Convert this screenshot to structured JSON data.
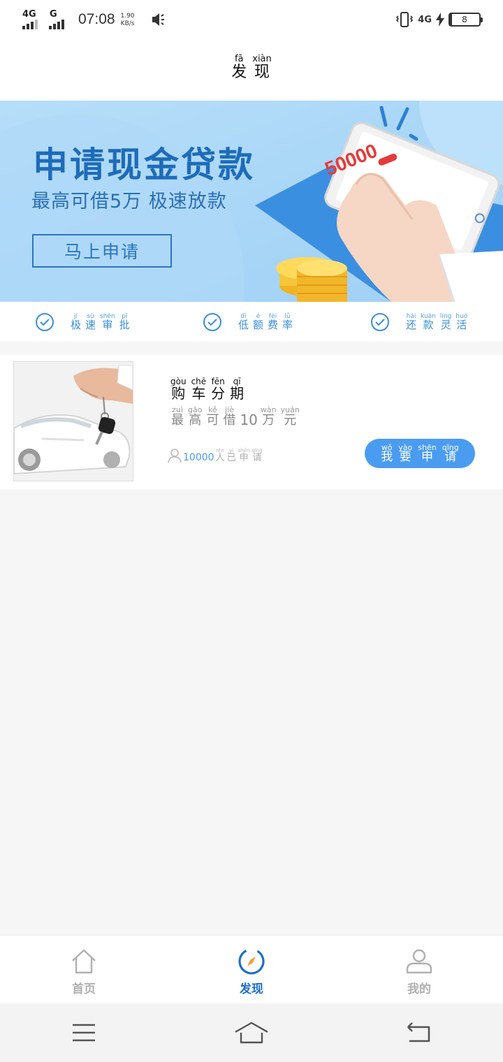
{
  "status_bar": {
    "sim1_type": "4G",
    "sim2_type": "G",
    "time": "07:08",
    "speed_value": "1.90",
    "speed_unit": "KB/s",
    "network_right": "4G",
    "battery_level": "8",
    "icons": [
      "mute-icon",
      "vibrate-icon",
      "charging-icon",
      "battery-icon"
    ]
  },
  "header": {
    "title": [
      {
        "char": "发",
        "pinyin": "fā"
      },
      {
        "char": "现",
        "pinyin": "xiàn"
      }
    ]
  },
  "banner": {
    "title": "申请现金贷款",
    "subtitle": "最高可借5万 极速放款",
    "button_label": "马上申请",
    "phone_amount": "50000",
    "colors": {
      "background": "#a6d6f7",
      "title": "#1e6cb9"
    }
  },
  "features": [
    {
      "chars": [
        {
          "char": "极",
          "pinyin": "jí"
        },
        {
          "char": "速",
          "pinyin": "sù"
        },
        {
          "char": "审",
          "pinyin": "shěn"
        },
        {
          "char": "批",
          "pinyin": "pī"
        }
      ]
    },
    {
      "chars": [
        {
          "char": "低",
          "pinyin": "dī"
        },
        {
          "char": "额",
          "pinyin": "é"
        },
        {
          "char": "费",
          "pinyin": "fèi"
        },
        {
          "char": "率",
          "pinyin": "lǜ"
        }
      ]
    },
    {
      "chars": [
        {
          "char": "还",
          "pinyin": "hái"
        },
        {
          "char": "款",
          "pinyin": "kuǎn"
        },
        {
          "char": "灵",
          "pinyin": "líng"
        },
        {
          "char": "活",
          "pinyin": "huó"
        }
      ]
    }
  ],
  "product": {
    "title": [
      {
        "char": "购",
        "pinyin": "gòu"
      },
      {
        "char": "车",
        "pinyin": "chē"
      },
      {
        "char": "分",
        "pinyin": "fēn"
      },
      {
        "char": "期",
        "pinyin": "qī"
      }
    ],
    "subtitle_before": [
      {
        "char": "最",
        "pinyin": "zuì"
      },
      {
        "char": "高",
        "pinyin": "gāo"
      },
      {
        "char": "可",
        "pinyin": "kě"
      },
      {
        "char": "借",
        "pinyin": "jiè"
      }
    ],
    "amount": "10",
    "subtitle_after": [
      {
        "char": "万",
        "pinyin": "wàn"
      },
      {
        "char": "元",
        "pinyin": "yuán"
      }
    ],
    "applicant_count": "10000",
    "applicant_label": [
      {
        "char": "人",
        "pinyin": "rén"
      },
      {
        "char": "已",
        "pinyin": "yǐ"
      },
      {
        "char": "申",
        "pinyin": "shēn"
      },
      {
        "char": "请",
        "pinyin": "qǐng"
      }
    ],
    "apply_button": [
      {
        "char": "我",
        "pinyin": "wǒ"
      },
      {
        "char": "要",
        "pinyin": "yào"
      },
      {
        "char": "申",
        "pinyin": "shēn"
      },
      {
        "char": "请",
        "pinyin": "qǐng"
      }
    ],
    "colors": {
      "button": "#4a9cf0"
    }
  },
  "tabbar": {
    "items": [
      {
        "label": "首页",
        "icon": "home-icon",
        "active": false
      },
      {
        "label": "发现",
        "icon": "compass-icon",
        "active": true
      },
      {
        "label": "我的",
        "icon": "profile-icon",
        "active": false
      }
    ],
    "colors": {
      "active": "#1f6fc4",
      "inactive": "#b0b0b0"
    }
  },
  "system_nav": {
    "icons": [
      "menu-icon",
      "home-nav-icon",
      "back-icon"
    ]
  }
}
